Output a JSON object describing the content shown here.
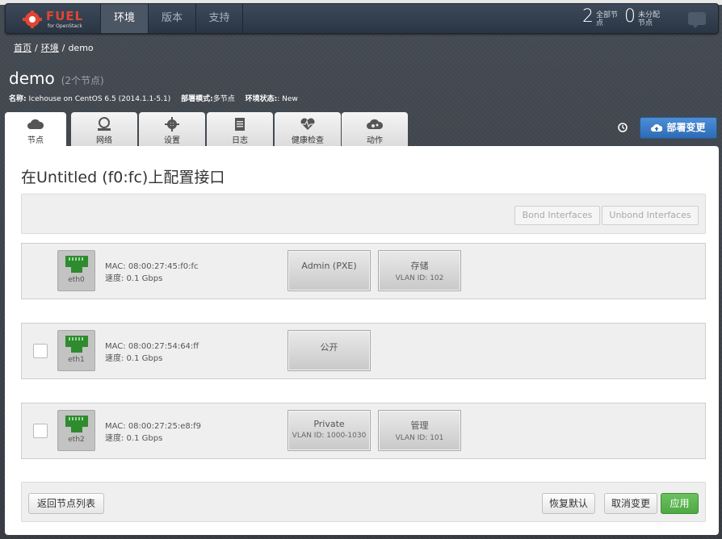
{
  "nav": {
    "logo_text": "FUEL",
    "logo_sub": "for OpenStack",
    "tabs": [
      "环境",
      "版本",
      "支持"
    ],
    "stats": [
      {
        "value": "2",
        "label": "全部节点"
      },
      {
        "value": "0",
        "label": "未分配节点"
      }
    ]
  },
  "breadcrumb": {
    "home": "首页",
    "envs": "环境",
    "current": "demo"
  },
  "env": {
    "name": "demo",
    "node_count": "(2个节点)",
    "info_name_label": "名称:",
    "info_name_value": "Icehouse on CentOS 6.5 (2014.1.1-5.1)",
    "info_mode_label": "部署模式:",
    "info_mode_value": "多节点",
    "info_status_label": "环境状态:",
    "info_status_value": ": New"
  },
  "tabs": [
    {
      "label": "节点",
      "icon": "cloud-icon"
    },
    {
      "label": "网络",
      "icon": "network-icon"
    },
    {
      "label": "设置",
      "icon": "gear-icon"
    },
    {
      "label": "日志",
      "icon": "clipboard-icon"
    },
    {
      "label": "健康检查",
      "icon": "heartbeat-icon"
    },
    {
      "label": "动作",
      "icon": "cloud-gears-icon"
    }
  ],
  "deploy_label": "部署变更",
  "page_title": "在Untitled (f0:fc)上配置接口",
  "bond": {
    "bond_label": "Bond Interfaces",
    "unbond_label": "Unbond Interfaces"
  },
  "interfaces": [
    {
      "name": "eth0",
      "mac": "MAC: 08:00:27:45:f0:fc",
      "speed": "速度: 0.1 Gbps",
      "networks": [
        {
          "name": "Admin (PXE)",
          "vlan": ""
        },
        {
          "name": "存储",
          "vlan": "VLAN ID: 102"
        }
      ]
    },
    {
      "name": "eth1",
      "mac": "MAC: 08:00:27:54:64:ff",
      "speed": "速度: 0.1 Gbps",
      "networks": [
        {
          "name": "公开",
          "vlan": ""
        }
      ]
    },
    {
      "name": "eth2",
      "mac": "MAC: 08:00:27:25:e8:f9",
      "speed": "速度: 0.1 Gbps",
      "networks": [
        {
          "name": "Private",
          "vlan": "VLAN ID: 1000-1030"
        },
        {
          "name": "管理",
          "vlan": "VLAN ID: 101"
        }
      ]
    }
  ],
  "footer": {
    "back_label": "返回节点列表",
    "reset_label": "恢复默认",
    "cancel_label": "取消变更",
    "apply_label": "应用"
  },
  "colors": {
    "accent_blue": "#2d6cb5",
    "apply_green": "#4ea844",
    "port_green": "#2e8b2e",
    "logo_red": "#e04534"
  }
}
